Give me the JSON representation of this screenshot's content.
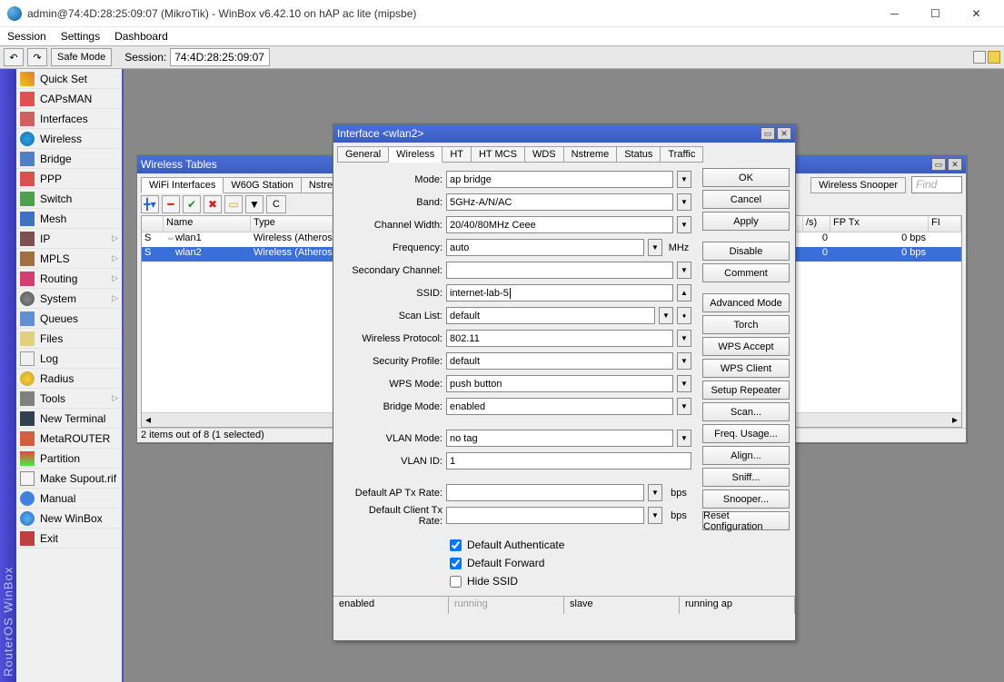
{
  "title": "admin@74:4D:28:25:09:07 (MikroTik) - WinBox v6.42.10 on hAP ac lite (mipsbe)",
  "menubar": [
    "Session",
    "Settings",
    "Dashboard"
  ],
  "toolbar": {
    "safe_mode": "Safe Mode",
    "session_label": "Session:",
    "session_value": "74:4D:28:25:09:07"
  },
  "vbar": "RouterOS WinBox",
  "sidebar": [
    {
      "label": "Quick Set",
      "icn": "ic-quick"
    },
    {
      "label": "CAPsMAN",
      "icn": "ic-caps"
    },
    {
      "label": "Interfaces",
      "icn": "ic-int"
    },
    {
      "label": "Wireless",
      "icn": "ic-wire"
    },
    {
      "label": "Bridge",
      "icn": "ic-bridge"
    },
    {
      "label": "PPP",
      "icn": "ic-ppp"
    },
    {
      "label": "Switch",
      "icn": "ic-switch"
    },
    {
      "label": "Mesh",
      "icn": "ic-mesh"
    },
    {
      "label": "IP",
      "icn": "ic-ip",
      "arrow": true
    },
    {
      "label": "MPLS",
      "icn": "ic-mpls",
      "arrow": true
    },
    {
      "label": "Routing",
      "icn": "ic-route",
      "arrow": true
    },
    {
      "label": "System",
      "icn": "ic-sys",
      "arrow": true
    },
    {
      "label": "Queues",
      "icn": "ic-queue"
    },
    {
      "label": "Files",
      "icn": "ic-files"
    },
    {
      "label": "Log",
      "icn": "ic-log"
    },
    {
      "label": "Radius",
      "icn": "ic-radius"
    },
    {
      "label": "Tools",
      "icn": "ic-tools",
      "arrow": true
    },
    {
      "label": "New Terminal",
      "icn": "ic-term"
    },
    {
      "label": "MetaROUTER",
      "icn": "ic-meta"
    },
    {
      "label": "Partition",
      "icn": "ic-part"
    },
    {
      "label": "Make Supout.rif",
      "icn": "ic-sup"
    },
    {
      "label": "Manual",
      "icn": "ic-man"
    },
    {
      "label": "New WinBox",
      "icn": "ic-new"
    },
    {
      "label": "Exit",
      "icn": "ic-exit"
    }
  ],
  "wtable": {
    "title": "Wireless Tables",
    "tabs1": [
      "WiFi Interfaces",
      "W60G Station",
      "Nstreme"
    ],
    "right_btns": [
      "Wireless Snooper"
    ],
    "find": "Find",
    "cols": [
      "",
      "Name",
      "Type",
      "/s)",
      "FP Tx",
      "FI"
    ],
    "rows": [
      {
        "flag": "S",
        "name": "wlan1",
        "type": "Wireless (Atheros",
        "v1": "0",
        "v2": "0 bps"
      },
      {
        "flag": "S",
        "name": "wlan2",
        "type": "Wireless (Atheros",
        "v1": "0",
        "v2": "0 bps",
        "sel": true
      }
    ],
    "status": "2 items out of 8 (1 selected)"
  },
  "dialog": {
    "title": "Interface <wlan2>",
    "tabs": [
      "General",
      "Wireless",
      "HT",
      "HT MCS",
      "WDS",
      "Nstreme",
      "Status",
      "Traffic"
    ],
    "active_tab": 1,
    "fields": {
      "mode": {
        "label": "Mode:",
        "value": "ap bridge"
      },
      "band": {
        "label": "Band:",
        "value": "5GHz-A/N/AC"
      },
      "chwidth": {
        "label": "Channel Width:",
        "value": "20/40/80MHz Ceee"
      },
      "freq": {
        "label": "Frequency:",
        "value": "auto",
        "unit": "MHz"
      },
      "sec_ch": {
        "label": "Secondary Channel:",
        "value": ""
      },
      "ssid": {
        "label": "SSID:",
        "value": "internet-lab-5"
      },
      "scan": {
        "label": "Scan List:",
        "value": "default"
      },
      "proto": {
        "label": "Wireless Protocol:",
        "value": "802.11"
      },
      "secprof": {
        "label": "Security Profile:",
        "value": "default"
      },
      "wps": {
        "label": "WPS Mode:",
        "value": "push button"
      },
      "bridge": {
        "label": "Bridge Mode:",
        "value": "enabled"
      },
      "vlanm": {
        "label": "VLAN Mode:",
        "value": "no tag"
      },
      "vlanid": {
        "label": "VLAN ID:",
        "value": "1"
      },
      "aptx": {
        "label": "Default AP Tx Rate:",
        "value": "",
        "unit": "bps"
      },
      "cltx": {
        "label": "Default Client Tx Rate:",
        "value": "",
        "unit": "bps"
      }
    },
    "checks": {
      "auth": "Default Authenticate",
      "fwd": "Default Forward",
      "hide": "Hide SSID"
    },
    "buttons": [
      "OK",
      "Cancel",
      "Apply",
      "Disable",
      "Comment",
      "Advanced Mode",
      "Torch",
      "WPS Accept",
      "WPS Client",
      "Setup Repeater",
      "Scan...",
      "Freq. Usage...",
      "Align...",
      "Sniff...",
      "Snooper...",
      "Reset Configuration"
    ],
    "status": [
      "enabled",
      "running",
      "slave",
      "running ap"
    ]
  }
}
